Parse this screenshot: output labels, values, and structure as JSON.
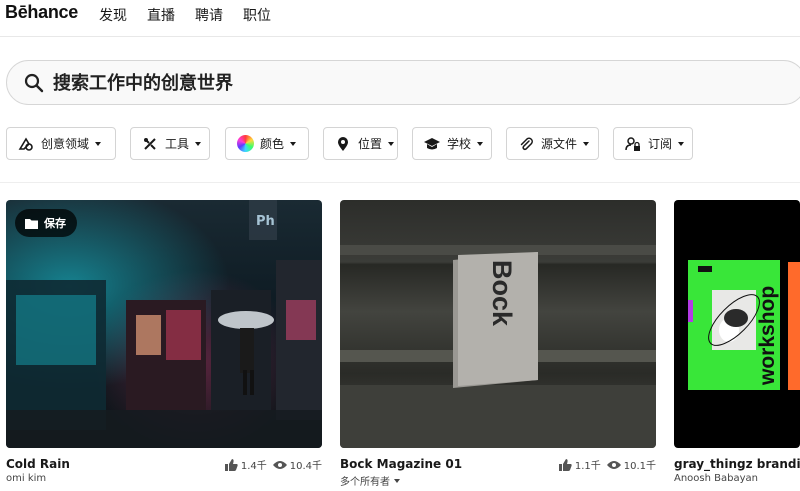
{
  "nav": {
    "logo": "Bēhance",
    "links": [
      "发现",
      "直播",
      "聘请",
      "职位"
    ]
  },
  "search": {
    "placeholder": "搜索工作中的创意世界"
  },
  "filters": [
    {
      "label": "创意领域",
      "icon": "creative-field-icon"
    },
    {
      "label": "工具",
      "icon": "tools-icon"
    },
    {
      "label": "颜色",
      "icon": "color-wheel-icon"
    },
    {
      "label": "位置",
      "icon": "location-pin-icon"
    },
    {
      "label": "学校",
      "icon": "graduation-cap-icon"
    },
    {
      "label": "源文件",
      "icon": "paperclip-icon"
    },
    {
      "label": "订阅",
      "icon": "lock-user-icon"
    }
  ],
  "projects": [
    {
      "title": "Cold Rain",
      "owner": "omi kim",
      "likes": "1.4千",
      "views": "10.4千",
      "save_label": "保存",
      "tool_badge": "Ph"
    },
    {
      "title": "Bock Magazine 01",
      "owner": "多个所有者",
      "likes": "1.1千",
      "views": "10.1千",
      "book_text": "Bock"
    },
    {
      "title": "gray_thingz branding",
      "owner": "Anoosh Babayan",
      "poster_text": "workshop"
    }
  ],
  "colors": {
    "accent_green": "#39e639",
    "accent_orange": "#ff6a2b",
    "neon_cyan": "#1ad4e6"
  }
}
